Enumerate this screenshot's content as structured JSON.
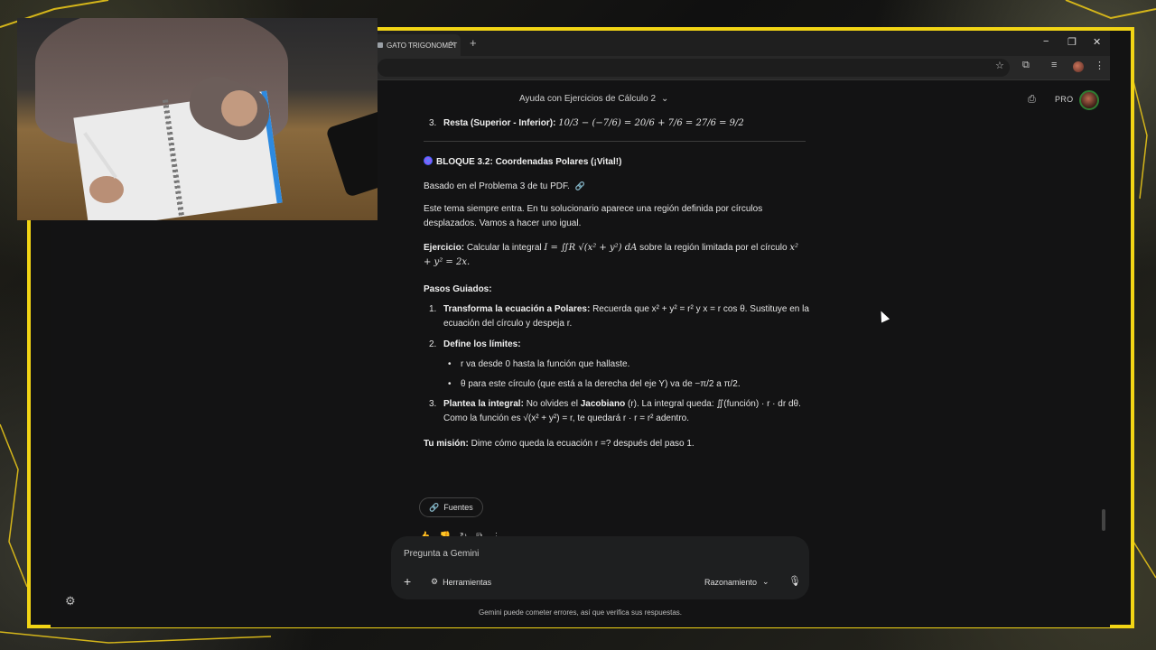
{
  "browser": {
    "tab_title": "GATO TRIGONOMÉT",
    "tab_close": "×",
    "new_tab": "+",
    "minimize": "−",
    "restore": "❐",
    "close": "✕"
  },
  "gemini": {
    "chat_title": "Ayuda con Ejercicios de Cálculo 2",
    "pro_label": "PRO"
  },
  "content": {
    "prev_item_num": "3.",
    "prev_item_label": "Resta (Superior - Inferior):",
    "prev_item_math": "10/3 − (−7/6) = 20/6 + 7/6 = 27/6 = 9/2",
    "block_title": "BLOQUE 3.2: Coordenadas Polares (¡Vital!)",
    "based_on": "Basado en el Problema 3 de tu PDF.",
    "intro": "Este tema siempre entra. En tu solucionario aparece una región definida por círculos desplazados. Vamos a hacer uno igual.",
    "exercise_label": "Ejercicio:",
    "exercise_text_1": "Calcular la integral",
    "exercise_math": "I = ∬R √(x² + y²) dA",
    "exercise_text_2": "sobre la región limitada por el círculo",
    "exercise_math_2": "x² + y² = 2x.",
    "steps_heading": "Pasos Guiados:",
    "step1_num": "1.",
    "step1_label": "Transforma la ecuación a Polares:",
    "step1_text": "Recuerda que x² + y² = r² y x = r cos θ. Sustituye en la ecuación del círculo y despeja r.",
    "step2_num": "2.",
    "step2_label": "Define los límites:",
    "step2_bullet1": "r va desde 0 hasta la función que hallaste.",
    "step2_bullet2": "θ para este círculo (que está a la derecha del eje Y) va de −π/2 a π/2.",
    "step3_num": "3.",
    "step3_label": "Plantea la integral:",
    "step3_text_1": "No olvides el",
    "step3_jacobiano": "Jacobiano",
    "step3_text_2": "(r). La integral queda: ∬(función) · r ·",
    "step3_text_3": "dr dθ. Como la función es √(x² + y²) = r, te quedará r · r = r² adentro.",
    "mission_label": "Tu misión:",
    "mission_text": "Dime cómo queda la ecuación r =? después del paso 1.",
    "sources_label": "Fuentes"
  },
  "input": {
    "placeholder": "Pregunta a Gemini",
    "tools_label": "Herramientas",
    "mode_label": "Razonamiento"
  },
  "disclaimer": "Gemini puede cometer errores, así que verifica sus respuestas."
}
